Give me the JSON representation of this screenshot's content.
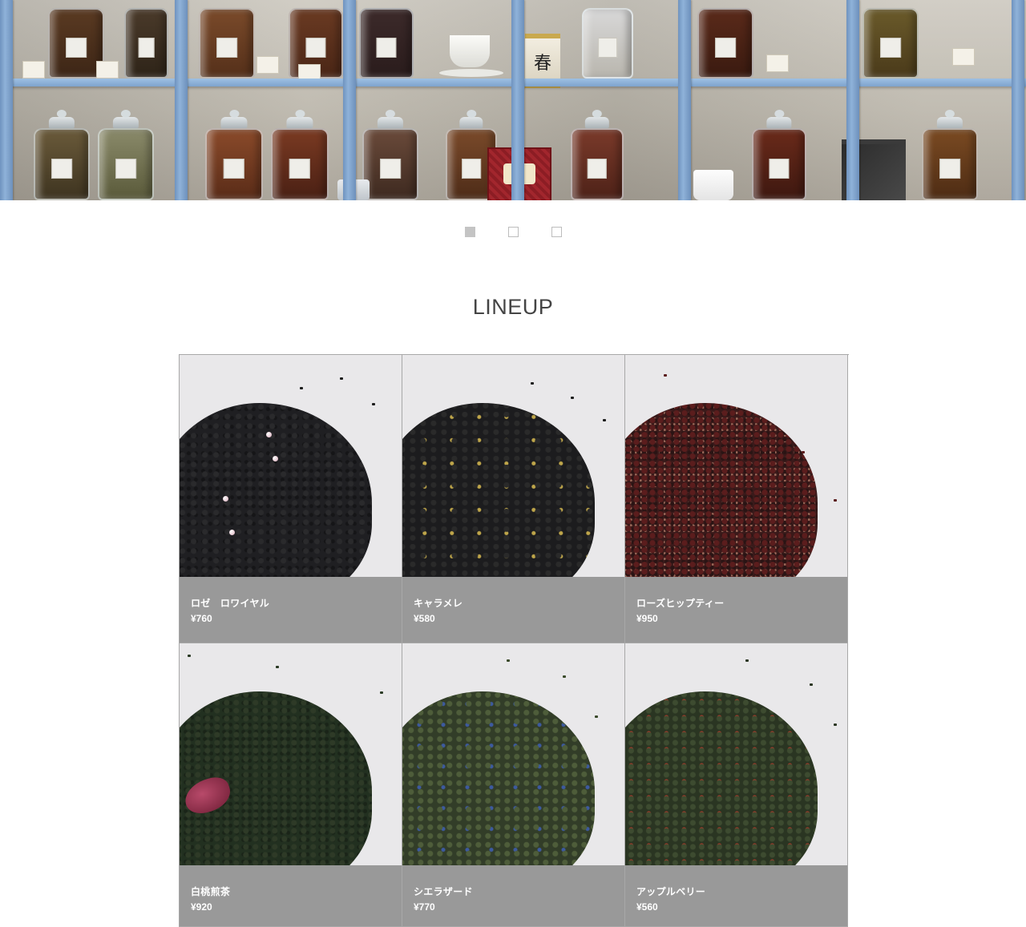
{
  "hero": {
    "kanji": "春"
  },
  "slider": {
    "dots": [
      {
        "label": "slide-1",
        "active": true
      },
      {
        "label": "slide-2",
        "active": false
      },
      {
        "label": "slide-3",
        "active": false
      }
    ]
  },
  "lineup": {
    "title": "LINEUP",
    "products": [
      {
        "name": "ロゼ　ロワイヤル",
        "price": "¥760"
      },
      {
        "name": "キャラメレ",
        "price": "¥580"
      },
      {
        "name": "ローズヒップティー",
        "price": "¥950"
      },
      {
        "name": "白桃煎茶",
        "price": "¥920"
      },
      {
        "name": "シエラザード",
        "price": "¥770"
      },
      {
        "name": "アップルベリー",
        "price": "¥560"
      }
    ]
  },
  "colors": {
    "info_bar": "#999999",
    "active_dot": "#c4c4c4",
    "shelf_blue": "#8fb2d9"
  }
}
